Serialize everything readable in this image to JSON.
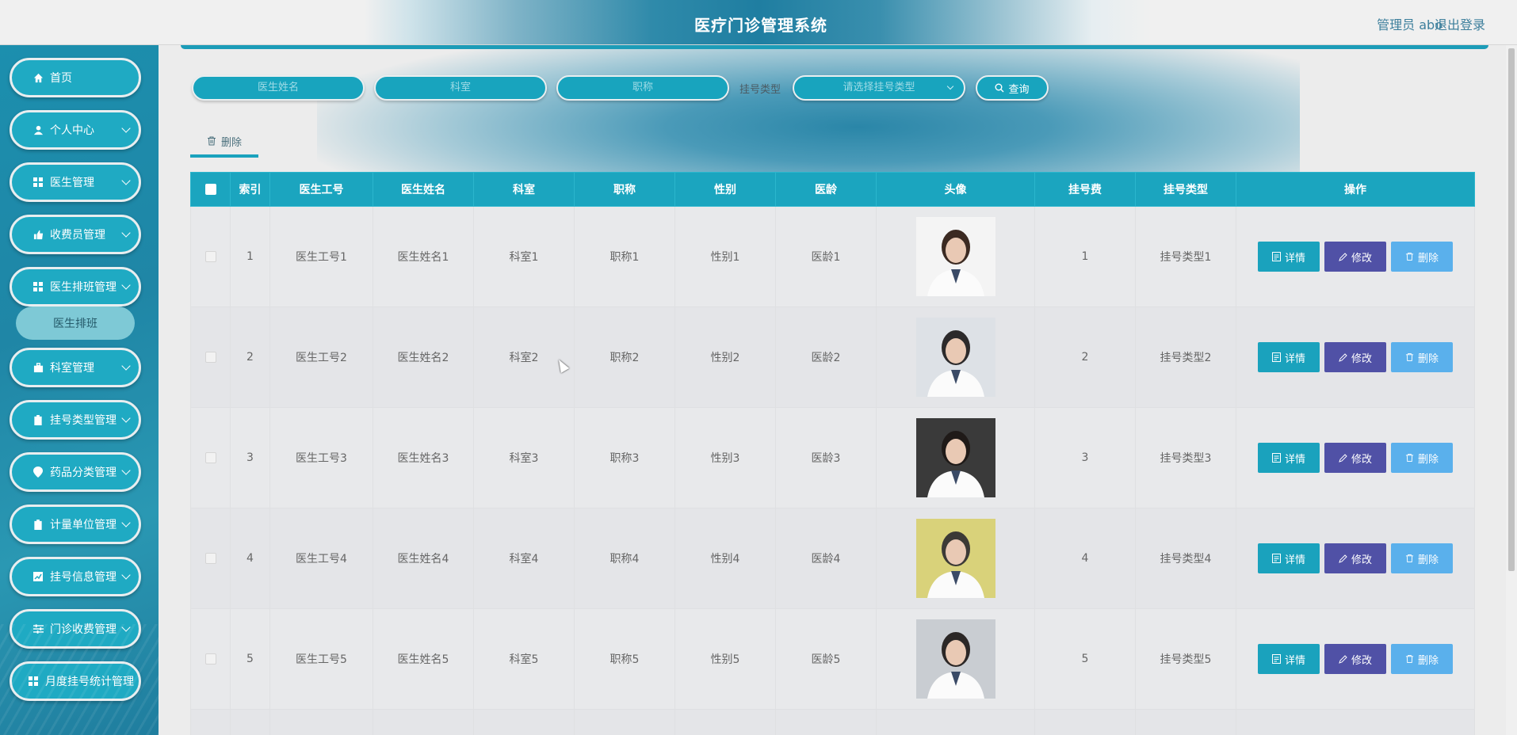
{
  "header": {
    "title": "医疗门诊管理系统",
    "user_label": "管理员 abo",
    "logout_label": "退出登录"
  },
  "sidebar": {
    "items": [
      {
        "label": "首页",
        "icon": "home-icon"
      },
      {
        "label": "个人中心",
        "icon": "user-icon"
      },
      {
        "label": "医生管理",
        "icon": "grid-icon"
      },
      {
        "label": "收费员管理",
        "icon": "thumb-icon"
      },
      {
        "label": "医生排班管理",
        "icon": "grid-icon"
      },
      {
        "label": "科室管理",
        "icon": "briefcase-icon"
      },
      {
        "label": "挂号类型管理",
        "icon": "clipboard-icon"
      },
      {
        "label": "药品分类管理",
        "icon": "location-icon"
      },
      {
        "label": "计量单位管理",
        "icon": "clipboard-icon"
      },
      {
        "label": "挂号信息管理",
        "icon": "chart-icon"
      },
      {
        "label": "门诊收费管理",
        "icon": "sliders-icon"
      },
      {
        "label": "月度挂号统计管理",
        "icon": "grid-icon"
      }
    ],
    "submenu": {
      "label": "医生排班"
    }
  },
  "search": {
    "doctor_name_placeholder": "医生姓名",
    "department_placeholder": "科室",
    "title_placeholder": "职称",
    "reg_type_label": "挂号类型",
    "reg_type_placeholder": "请选择挂号类型",
    "query_label": "查询"
  },
  "toolbar": {
    "delete_label": "删除"
  },
  "table": {
    "columns": [
      "索引",
      "医生工号",
      "医生姓名",
      "科室",
      "职称",
      "性别",
      "医龄",
      "头像",
      "挂号费",
      "挂号类型",
      "操作"
    ],
    "rows": [
      {
        "index": "1",
        "id": "医生工号1",
        "name": "医生姓名1",
        "dept": "科室1",
        "title": "职称1",
        "gender": "性别1",
        "years": "医龄1",
        "fee": "1",
        "type": "挂号类型1"
      },
      {
        "index": "2",
        "id": "医生工号2",
        "name": "医生姓名2",
        "dept": "科室2",
        "title": "职称2",
        "gender": "性别2",
        "years": "医龄2",
        "fee": "2",
        "type": "挂号类型2"
      },
      {
        "index": "3",
        "id": "医生工号3",
        "name": "医生姓名3",
        "dept": "科室3",
        "title": "职称3",
        "gender": "性别3",
        "years": "医龄3",
        "fee": "3",
        "type": "挂号类型3"
      },
      {
        "index": "4",
        "id": "医生工号4",
        "name": "医生姓名4",
        "dept": "科室4",
        "title": "职称4",
        "gender": "性别4",
        "years": "医龄4",
        "fee": "4",
        "type": "挂号类型4"
      },
      {
        "index": "5",
        "id": "医生工号5",
        "name": "医生姓名5",
        "dept": "科室5",
        "title": "职称5",
        "gender": "性别5",
        "years": "医龄5",
        "fee": "5",
        "type": "挂号类型5"
      }
    ],
    "actions": {
      "detail": "详情",
      "edit": "修改",
      "delete": "删除"
    }
  },
  "colors": {
    "accent": "#1ba5bf",
    "edit": "#5051a6",
    "delete": "#5ab0ec"
  }
}
